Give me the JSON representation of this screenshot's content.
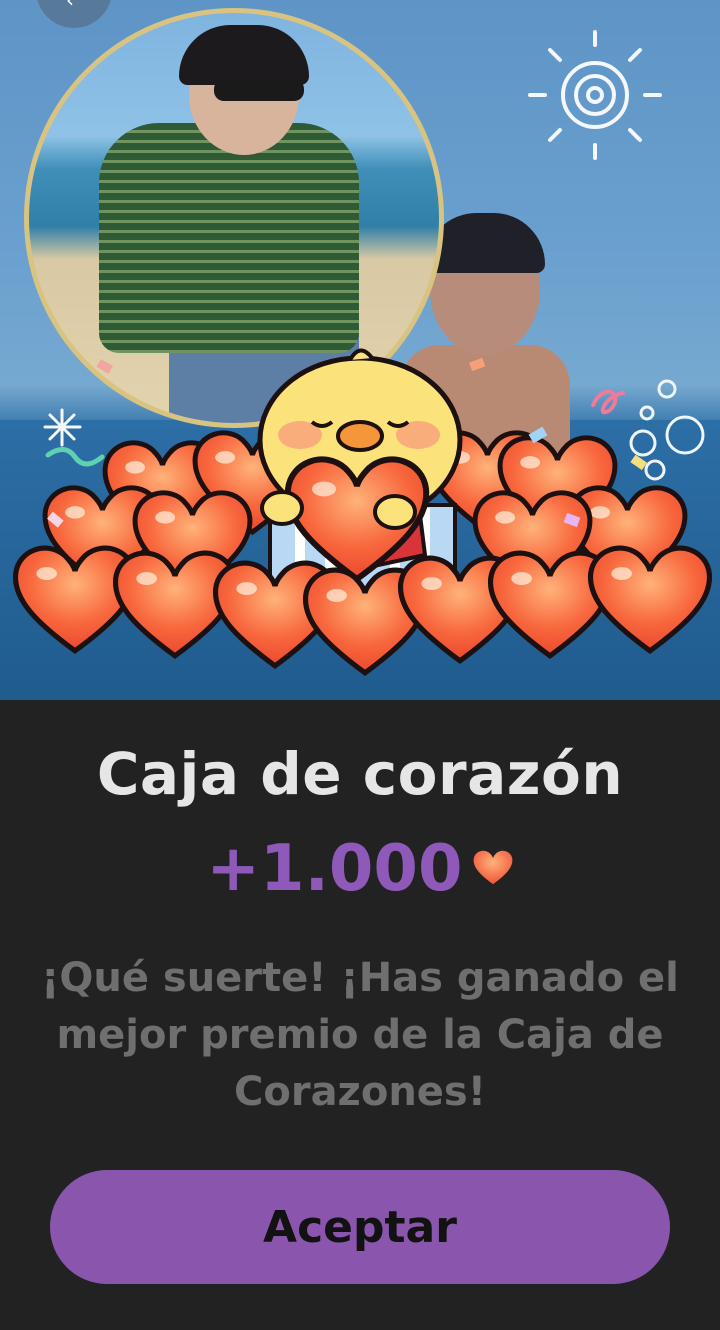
{
  "reward_popup": {
    "title": "Caja de corazón",
    "amount": "+1.000",
    "amount_icon": "heart-icon",
    "message": "¡Qué suerte! ¡Has ganado el mejor premio de la Caja de Corazones!",
    "accept_label": "Aceptar"
  },
  "colors": {
    "background": "#222222",
    "accent": "#8a55ad",
    "amount_text": "#8e59b8",
    "title_text": "#e6e6e6",
    "message_text": "#6f6f6f",
    "heart": "#f2603a"
  },
  "icons": {
    "back": "chevron-left-icon",
    "mascot": "chick-mascot-icon",
    "sun": "sun-doodle-icon",
    "bubbles": "bubbles-doodle-icon"
  }
}
